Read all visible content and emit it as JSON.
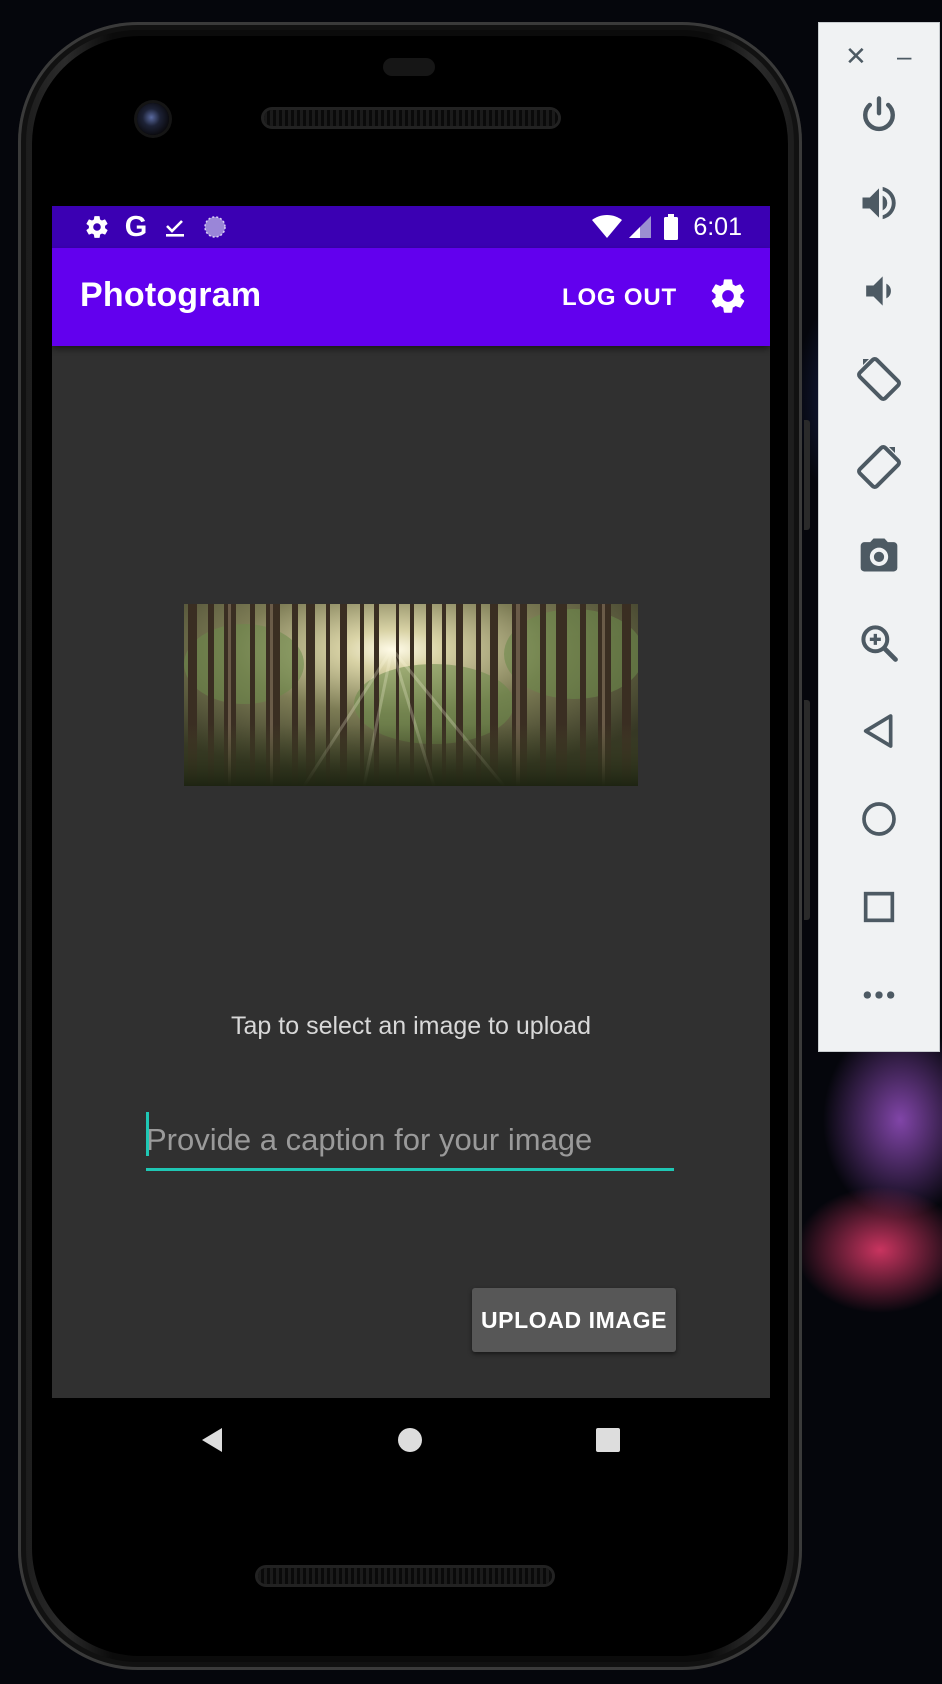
{
  "app": {
    "title": "Photogram",
    "logout_label": "LOG OUT"
  },
  "status_bar": {
    "time": "6:01",
    "left_icons": [
      "gear-icon",
      "google-icon",
      "download-done-icon",
      "circle-dots-icon"
    ],
    "right_icons": [
      "wifi-icon",
      "signal-icon",
      "battery-icon"
    ]
  },
  "upload": {
    "hint": "Tap to select an image to upload",
    "caption_placeholder": "Provide a caption for your image",
    "caption_value": "",
    "button_label": "UPLOAD IMAGE"
  },
  "nav_bar": {
    "buttons": [
      "back-icon",
      "home-icon",
      "recents-icon"
    ]
  },
  "emulator_panel": {
    "buttons": [
      "close-icon",
      "minimize-icon",
      "power-icon",
      "volume-up-icon",
      "volume-down-icon",
      "rotate-left-icon",
      "rotate-right-icon",
      "camera-icon",
      "zoom-icon",
      "back-icon",
      "home-icon",
      "overview-icon",
      "more-icon"
    ]
  },
  "colors": {
    "status_bar": "#3b00b3",
    "app_bar": "#6200ee",
    "screen_background": "#303030",
    "accent": "#1fc7b4",
    "button": "#575757"
  }
}
